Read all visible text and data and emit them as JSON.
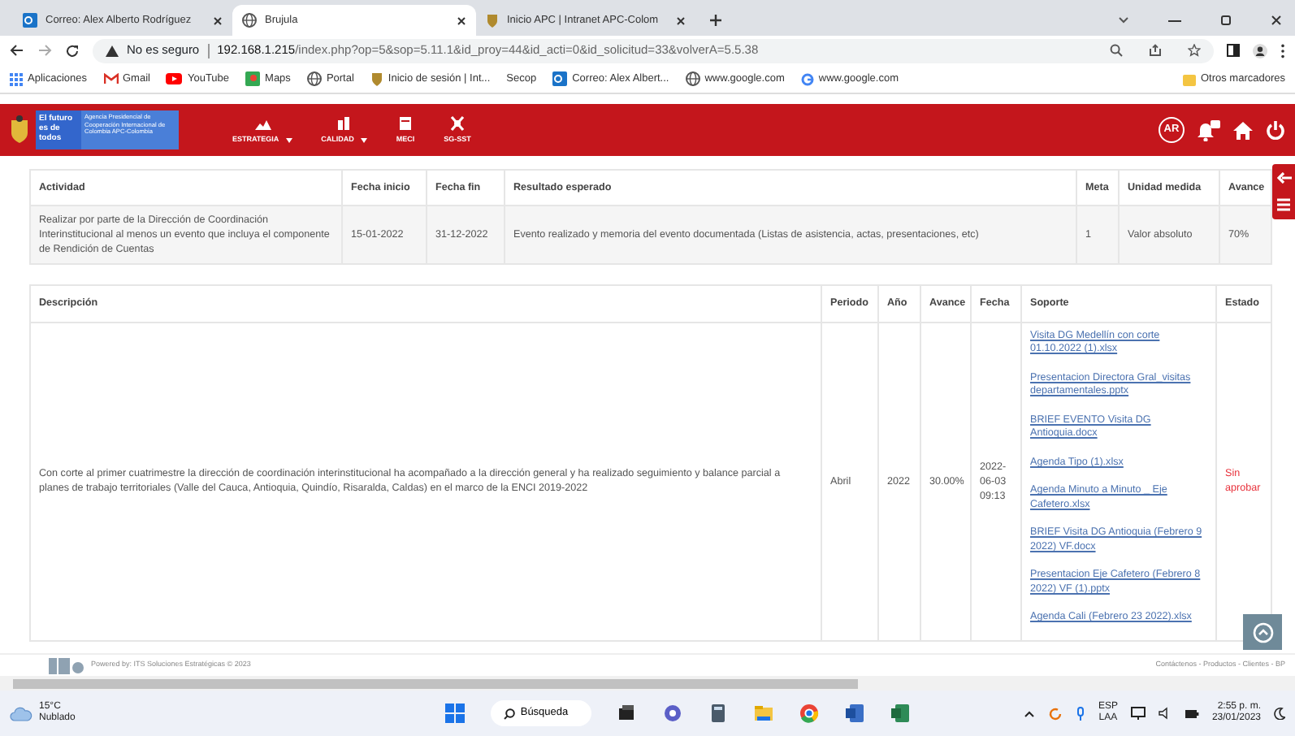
{
  "browser": {
    "tabs": [
      {
        "title": "Correo: Alex Alberto Rodríguez",
        "kind": "mail",
        "selected": false
      },
      {
        "title": "Brujula",
        "kind": "globe",
        "selected": true
      },
      {
        "title": "Inicio APC | Intranet APC-Colom",
        "kind": "shield",
        "selected": false
      }
    ],
    "address": {
      "warning": "No es seguro",
      "host": "192.168.1.215",
      "path": "/index.php?op=5&sop=5.11.1&id_proy=44&id_acti=0&id_solicitud=33&volverA=5.5.38"
    },
    "bookmarks": [
      {
        "label": "Aplicaciones",
        "kind": "apps"
      },
      {
        "label": "Gmail",
        "kind": "gmail"
      },
      {
        "label": "YouTube",
        "kind": "youtube"
      },
      {
        "label": "Maps",
        "kind": "maps"
      },
      {
        "label": "Portal",
        "kind": "globe"
      },
      {
        "label": "Inicio de sesión | Int...",
        "kind": "shield"
      },
      {
        "label": "Secop",
        "kind": "none"
      },
      {
        "label": "Correo: Alex Albert...",
        "kind": "mail"
      },
      {
        "label": "www.google.com",
        "kind": "globe"
      },
      {
        "label": "www.google.com",
        "kind": "google"
      }
    ],
    "other_bookmarks": "Otros marcadores"
  },
  "header": {
    "slogan": "El futuro es de todos",
    "agency": "Agencia Presidencial de Cooperación Internacional de Colombia APC-Colombia",
    "nav": [
      {
        "label": "ESTRATEGIA",
        "dropdown": true
      },
      {
        "label": "CALIDAD",
        "dropdown": true
      },
      {
        "label": "MECI",
        "dropdown": false
      },
      {
        "label": "SG-SST",
        "dropdown": false
      }
    ],
    "avatar": "AR"
  },
  "activity_table": {
    "columns": [
      "Actividad",
      "Fecha inicio",
      "Fecha fin",
      "Resultado esperado",
      "Meta",
      "Unidad medida",
      "Avance"
    ],
    "rows": [
      [
        "Realizar por parte de la Dirección de Coordinación Interinstitucional al menos un evento que incluya el componente de Rendición de Cuentas",
        "15-01-2022",
        "31-12-2022",
        "Evento realizado y memoria del evento documentada (Listas de asistencia, actas, presentaciones, etc)",
        "1",
        "Valor absoluto",
        "70%"
      ]
    ]
  },
  "report_table": {
    "columns": [
      "Descripción",
      "Periodo",
      "Año",
      "Avance",
      "Fecha",
      "Soporte",
      "Estado"
    ],
    "rows": [
      {
        "description": "Con corte al primer cuatrimestre la dirección de coordinación interinstitucional ha acompañado a la dirección general y ha realizado seguimiento y balance parcial a planes de trabajo territoriales (Valle del Cauca, Antioquia, Quindío, Risaralda, Caldas) en el marco de la ENCI 2019-2022",
        "period": "Abril",
        "year": "2022",
        "progress": "30.00%",
        "date": "2022-06-03 09:13",
        "attachments": [
          "Visita DG Medellín con corte 01.10.2022 (1).xlsx",
          "Presentacion Directora Gral_visitas departamentales.pptx",
          "BRIEF EVENTO Visita DG Antioquia.docx",
          "Agenda Tipo (1).xlsx",
          "Agenda Minuto a Minuto _ Eje Cafetero.xlsx",
          "BRIEF Visita DG Antioquia (Febrero 9 2022) VF.docx",
          "Presentacion Eje Cafetero (Febrero 8 2022) VF (1).pptx",
          "Agenda Cali (Febrero 23 2022).xlsx"
        ],
        "status": "Sin aprobar",
        "approved": false
      }
    ]
  },
  "footer": {
    "powered": "Powered by: ITS Soluciones Estratégicas © 2023",
    "links": "Contáctenos - Productos - Clientes - BP"
  },
  "taskbar": {
    "temperature": "15°C",
    "weather": "Nublado",
    "search": "Búsqueda",
    "language": "ESP",
    "layout": "LAA",
    "time": "2:55 p. m.",
    "date": "23/01/2023"
  }
}
